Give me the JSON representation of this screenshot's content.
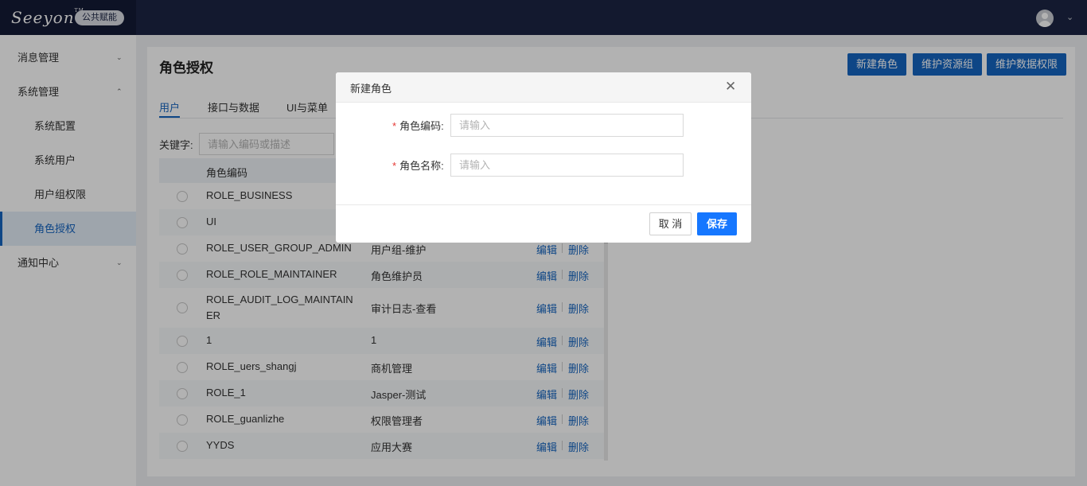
{
  "header": {
    "logo_text": "Seeyon",
    "logo_mark": "TM",
    "badge": "公共赋能",
    "avatar_icon": "user-avatar-icon",
    "dropdown_icon": "chevron-down-icon"
  },
  "sidebar": {
    "items": [
      {
        "label": "消息管理",
        "chevron": "chevron-down-icon"
      },
      {
        "label": "系统管理",
        "chevron": "chevron-up-icon"
      },
      {
        "label": "系统配置"
      },
      {
        "label": "系统用户"
      },
      {
        "label": "用户组权限"
      },
      {
        "label": "角色授权",
        "active": true
      },
      {
        "label": "通知中心",
        "chevron": "chevron-down-icon"
      }
    ]
  },
  "main": {
    "title": "角色授权",
    "actions": [
      "新建角色",
      "维护资源组",
      "维护数据权限"
    ],
    "tabs": [
      "用户",
      "接口与数据",
      "UI与菜单"
    ],
    "active_tab": "用户",
    "keyword_label": "关键字:",
    "keyword_placeholder": "请输入编码或描述",
    "table": {
      "col_code": "角色编码",
      "action_edit": "编辑",
      "action_delete": "删除",
      "rows": [
        {
          "code": "ROLE_BUSINESS",
          "desc": ""
        },
        {
          "code": "UI",
          "desc": ""
        },
        {
          "code": "ROLE_USER_GROUP_ADMIN",
          "desc": "用户组-维护"
        },
        {
          "code": "ROLE_ROLE_MAINTAINER",
          "desc": "角色维护员"
        },
        {
          "code": "ROLE_AUDIT_LOG_MAINTAINER",
          "desc": "审计日志-查看"
        },
        {
          "code": "1",
          "desc": "1"
        },
        {
          "code": "ROLE_uers_shangj",
          "desc": "商机管理"
        },
        {
          "code": "ROLE_1",
          "desc": "Jasper-测试"
        },
        {
          "code": "ROLE_guanlizhe",
          "desc": "权限管理者"
        },
        {
          "code": "YYDS",
          "desc": "应用大赛"
        }
      ]
    }
  },
  "modal": {
    "title": "新建角色",
    "close_icon": "close-icon",
    "fields": [
      {
        "label": "角色编码:",
        "placeholder": "请输入",
        "value": ""
      },
      {
        "label": "角色名称:",
        "placeholder": "请输入",
        "value": ""
      }
    ],
    "cancel_label": "取 消",
    "save_label": "保存"
  },
  "colors": {
    "topbar": "#1c2544",
    "primary": "#1565c0",
    "save_button": "#1677ff",
    "required_mark": "#e53935"
  }
}
